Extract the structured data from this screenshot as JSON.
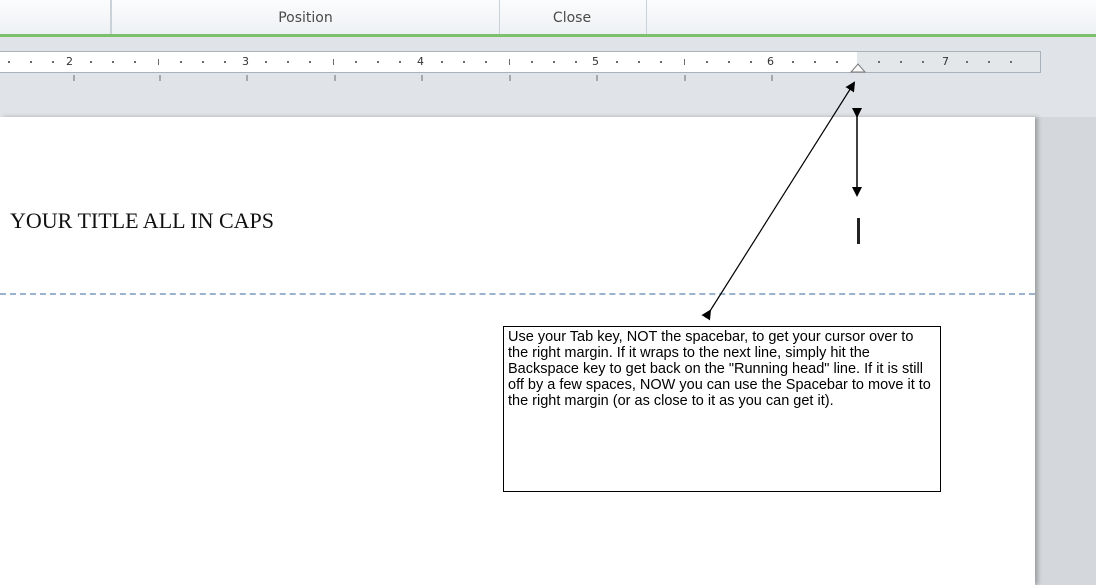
{
  "ribbon": {
    "groups": [
      "",
      "Position",
      "Close"
    ]
  },
  "ruler": {
    "numbers": [
      "2",
      "3",
      "4",
      "5",
      "6",
      "7"
    ]
  },
  "document": {
    "title_text": "YOUR TITLE ALL IN CAPS",
    "callout_text": "Use your Tab key, NOT the spacebar, to get your cursor over to the right margin. If it wraps to the next line, simply hit the Backspace key to get back on the \"Running head\" line. If it is still off by a few spaces, NOW you can use the Spacebar to move it to the right margin (or as close to it as you can get it)."
  },
  "colors": {
    "ribbon_accent": "#7dc06b",
    "header_divider": "#9bb3cf",
    "workspace_bg": "#d4d7db"
  }
}
